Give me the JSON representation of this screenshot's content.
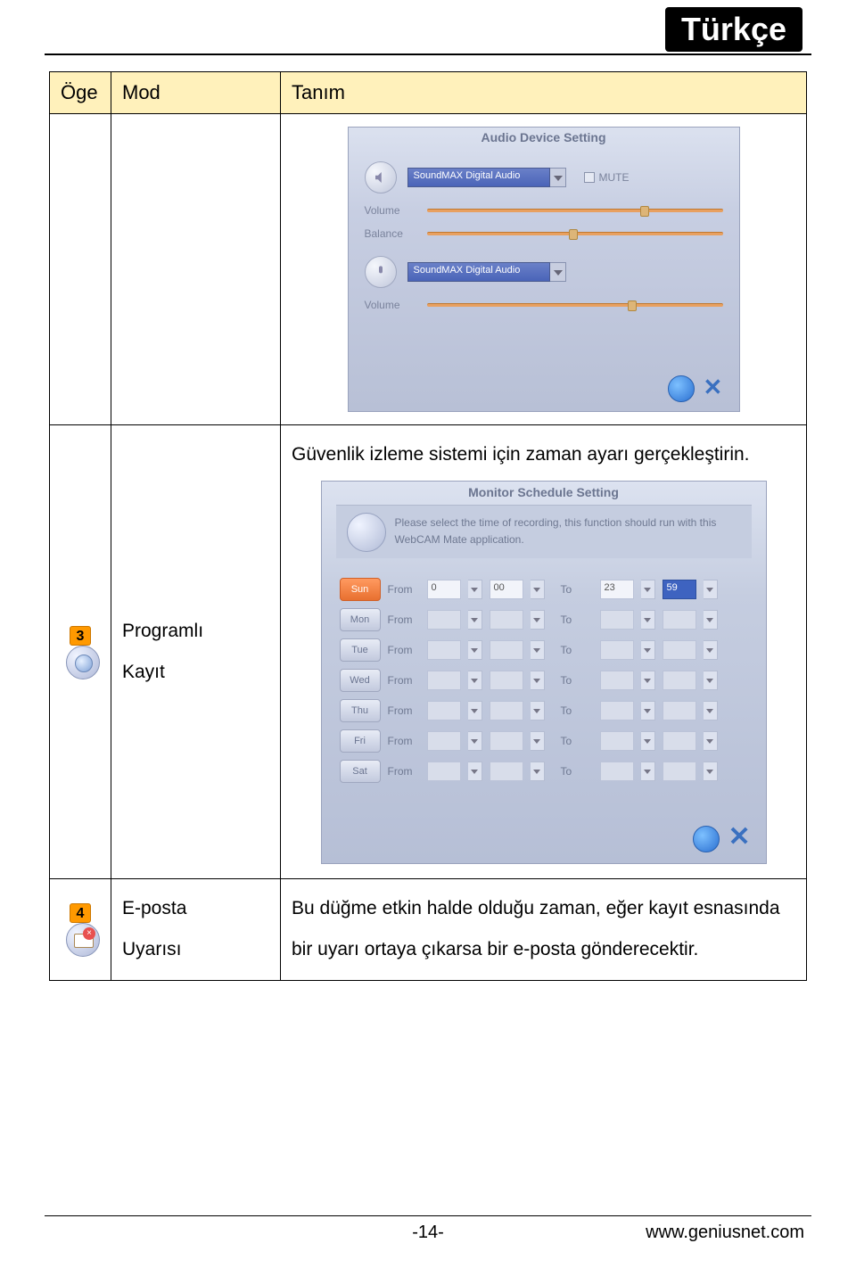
{
  "header": {
    "language": "Türkçe"
  },
  "table": {
    "headers": {
      "item": "Öge",
      "mode": "Mod",
      "desc": "Tanım"
    },
    "rows": [
      {
        "badge": "",
        "mode": "",
        "desc": "",
        "panel": "audio"
      },
      {
        "badge": "3",
        "mode_line1": "Programlı",
        "mode_line2": "Kayıt",
        "desc": "Güvenlik izleme sistemi için zaman ayarı gerçekleştirin.",
        "panel": "schedule"
      },
      {
        "badge": "4",
        "mode_line1": "E-posta",
        "mode_line2": "Uyarısı",
        "desc": "Bu düğme etkin halde olduğu zaman, eğer kayıt esnasında bir uyarı ortaya çıkarsa bir e-posta gönderecektir."
      }
    ]
  },
  "audio_panel": {
    "title": "Audio Device Setting",
    "device1": "SoundMAX Digital Audio",
    "mute": "MUTE",
    "volume": "Volume",
    "balance": "Balance",
    "device2": "SoundMAX Digital Audio"
  },
  "schedule_panel": {
    "title": "Monitor Schedule Setting",
    "info": "Please select the time of recording, this function should run with this WebCAM Mate application.",
    "from": "From",
    "to": "To",
    "days": [
      {
        "label": "Sun",
        "active": true,
        "from_h": "0",
        "from_m": "00",
        "to_h": "23",
        "to_m": "59"
      },
      {
        "label": "Mon",
        "active": false,
        "from_h": "",
        "from_m": "",
        "to_h": "",
        "to_m": ""
      },
      {
        "label": "Tue",
        "active": false,
        "from_h": "",
        "from_m": "",
        "to_h": "",
        "to_m": ""
      },
      {
        "label": "Wed",
        "active": false,
        "from_h": "",
        "from_m": "",
        "to_h": "",
        "to_m": ""
      },
      {
        "label": "Thu",
        "active": false,
        "from_h": "",
        "from_m": "",
        "to_h": "",
        "to_m": ""
      },
      {
        "label": "Fri",
        "active": false,
        "from_h": "",
        "from_m": "",
        "to_h": "",
        "to_m": ""
      },
      {
        "label": "Sat",
        "active": false,
        "from_h": "",
        "from_m": "",
        "to_h": "",
        "to_m": ""
      }
    ]
  },
  "footer": {
    "page": "-14-",
    "link": "www.geniusnet.com"
  }
}
